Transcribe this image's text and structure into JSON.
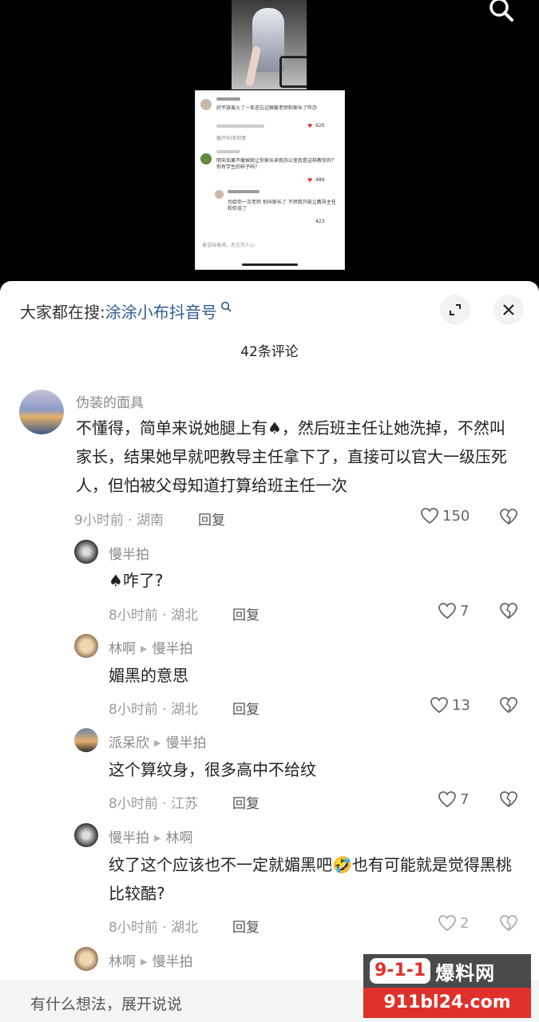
{
  "video_preview": {
    "comments": [
      {
        "text": "好不容易火了一条还忘记屏蔽老师和家长了咋办",
        "likes": "920"
      },
      {
        "text": "展开90条回复"
      },
      {
        "text": "明天如果不撤掉就让你家长来我办公室我是这样教你的？你有学生的样子吗？",
        "likes": "489"
      },
      {
        "text": "也给你一次老师 别叫家长了 不然我只能让教导主任和你说了",
        "likes": "423"
      }
    ],
    "input_placeholder": "善语结善缘，恶言伤人心"
  },
  "sheet": {
    "search_prefix": "大家都在搜:",
    "search_term": "涂涂小布抖音号",
    "comment_count": "42条评论"
  },
  "comments": [
    {
      "user": "伪装的面具",
      "text": "不懂得，简单来说她腿上有♠，然后班主任让她洗掉，不然叫家长，结果她早就吧教导主任拿下了，直接可以官大一级压死人，但怕被父母知道打算给班主任一次",
      "meta": "9小时前 · 湖南",
      "reply_label": "回复",
      "likes": "150"
    },
    {
      "user": "慢半拍",
      "text": "♠咋了?",
      "meta": "8小时前 · 湖北",
      "reply_label": "回复",
      "likes": "7"
    },
    {
      "user": "林啊",
      "reply_to": "慢半拍",
      "text": "媚黑的意思",
      "meta": "8小时前 · 湖北",
      "reply_label": "回复",
      "likes": "13"
    },
    {
      "user": "派呆欣",
      "reply_to": "慢半拍",
      "text": "这个算纹身，很多高中不给纹",
      "meta": "8小时前 · 江苏",
      "reply_label": "回复",
      "likes": "7"
    },
    {
      "user": "慢半拍",
      "reply_to": "林啊",
      "text": "纹了这个应该也不一定就媚黑吧🤣也有可能就是觉得黑桃比较酷?",
      "meta": "8小时前 · 湖北",
      "reply_label": "回复",
      "likes": "2"
    },
    {
      "user": "林啊",
      "reply_to": "慢半拍"
    }
  ],
  "input_placeholder": "有什么想法，展开说说",
  "watermark": {
    "logo": "9-1-1",
    "name": "爆料网",
    "url": "911bl24.com"
  },
  "colors": {
    "link": "#2f5a8e",
    "watermark_red": "#e0302a"
  }
}
